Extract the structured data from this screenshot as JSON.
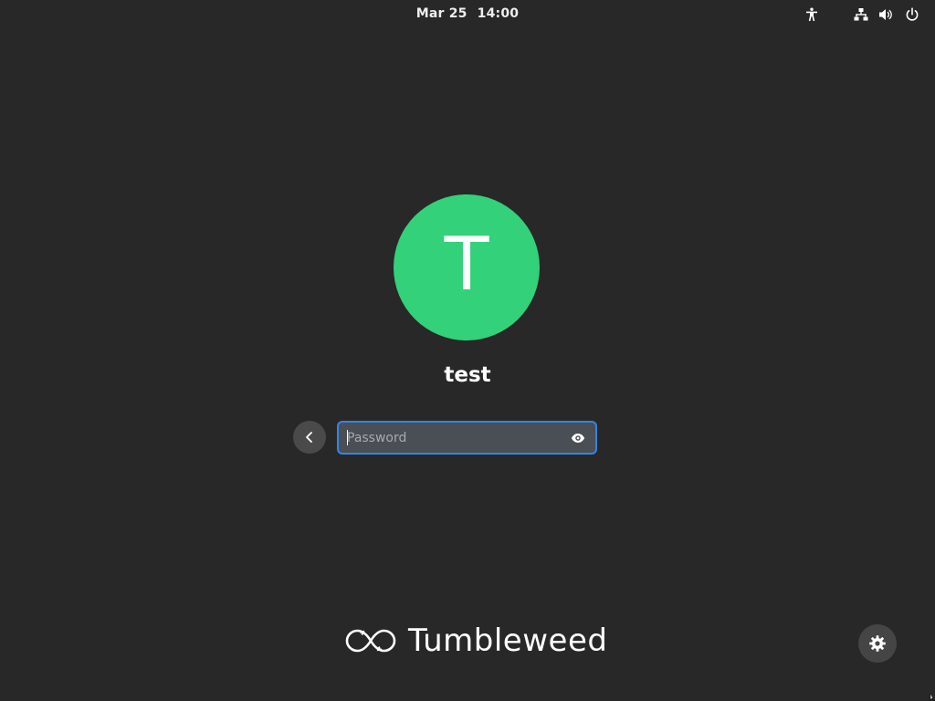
{
  "topbar": {
    "date": "Mar 25",
    "time": "14:00",
    "icons": [
      "accessibility-icon",
      "network-wired-icon",
      "volume-icon",
      "power-icon"
    ]
  },
  "user": {
    "avatar_letter": "T",
    "avatar_color": "#33d17a",
    "name": "test"
  },
  "login": {
    "password_placeholder": "Password",
    "password_value": "",
    "focus_color": "#3584e4"
  },
  "branding": {
    "logo_text": "Tumbleweed"
  },
  "colors": {
    "background": "#282828",
    "text": "#ffffff"
  }
}
